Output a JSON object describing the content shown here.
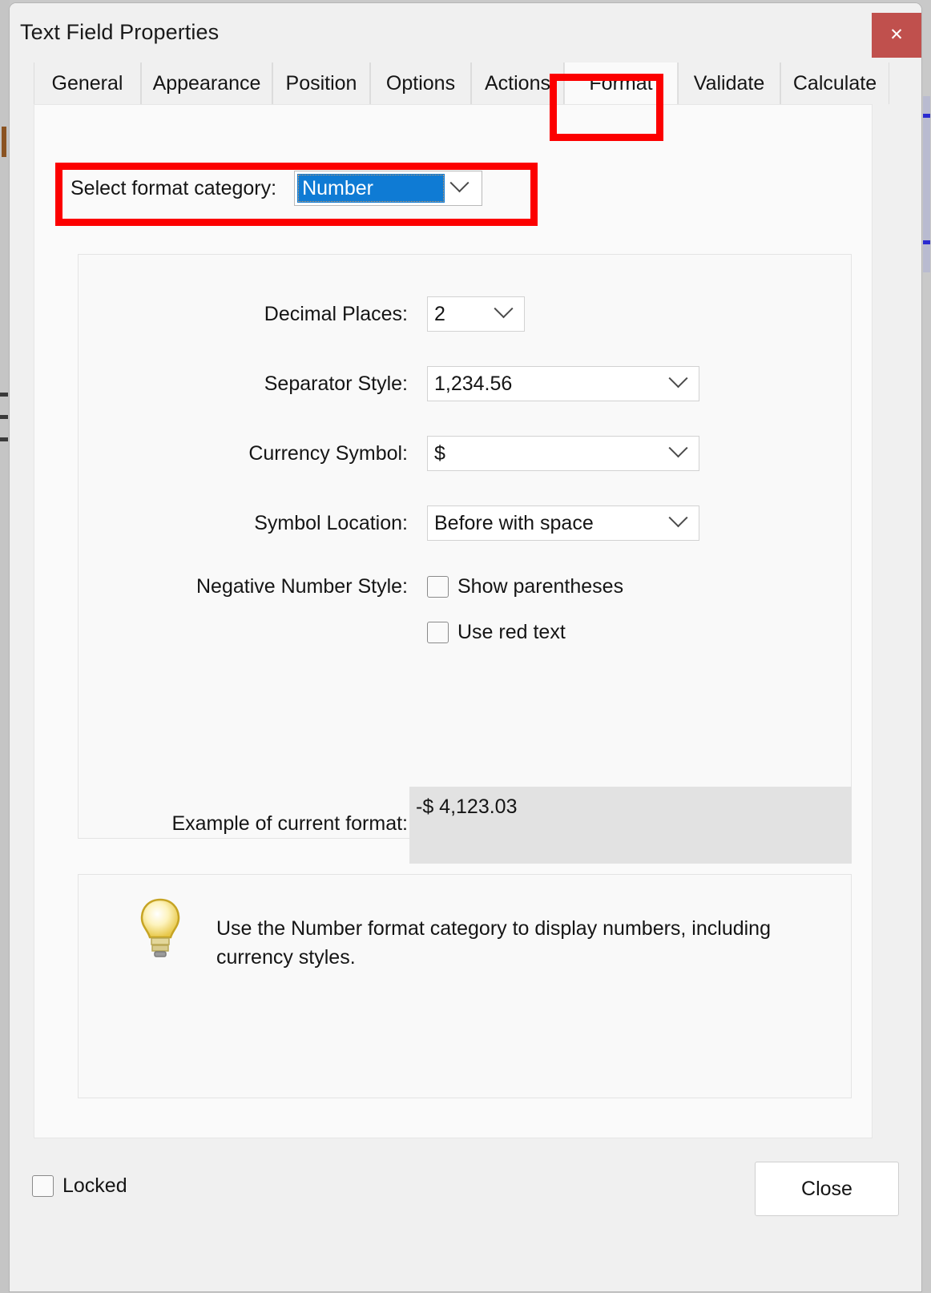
{
  "window": {
    "title": "Text Field Properties",
    "close_icon": "close-x-icon",
    "close_icon_glyph": "✕",
    "close_icon_color": "#c0504d"
  },
  "tabs": [
    {
      "label": "General",
      "selected": false
    },
    {
      "label": "Appearance",
      "selected": false
    },
    {
      "label": "Position",
      "selected": false
    },
    {
      "label": "Options",
      "selected": false
    },
    {
      "label": "Actions",
      "selected": false
    },
    {
      "label": "Format",
      "selected": true
    },
    {
      "label": "Validate",
      "selected": false
    },
    {
      "label": "Calculate",
      "selected": false
    }
  ],
  "highlights": {
    "color": "#fc0000",
    "targets": [
      "Format tab",
      "Select format category row"
    ]
  },
  "format_category": {
    "label": "Select format category:",
    "value": "Number",
    "selected_bg": "#0f7bd4",
    "selected_fg": "#ffffff",
    "arrow_icon": "chevron-down-icon"
  },
  "fields": {
    "decimal_places": {
      "label": "Decimal Places:",
      "value": "2",
      "arrow_icon": "chevron-down-icon"
    },
    "separator_style": {
      "label": "Separator Style:",
      "value": "1,234.56",
      "arrow_icon": "chevron-down-icon"
    },
    "currency_symbol": {
      "label": "Currency Symbol:",
      "value": "$",
      "arrow_icon": "chevron-down-icon"
    },
    "symbol_location": {
      "label": "Symbol Location:",
      "value": "Before with space",
      "arrow_icon": "chevron-down-icon"
    },
    "negative_number_style": {
      "label": "Negative Number Style:",
      "options": [
        {
          "label": "Show parentheses",
          "checked": false
        },
        {
          "label": "Use red text",
          "checked": false
        }
      ]
    },
    "example": {
      "label": "Example of current format:",
      "value": "-$ 4,123.03"
    }
  },
  "tip": {
    "icon": "lightbulb-icon",
    "text": "Use the Number format category to display numbers, including currency styles."
  },
  "footer": {
    "locked_label": "Locked",
    "locked_checked": false,
    "close_label": "Close"
  }
}
